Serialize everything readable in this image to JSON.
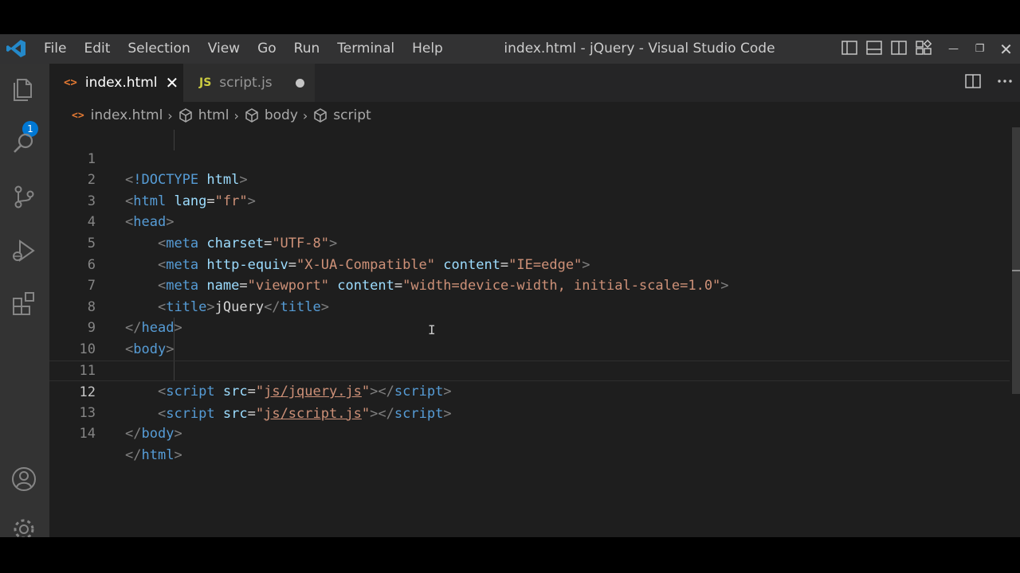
{
  "window": {
    "title": "index.html - jQuery - Visual Studio Code",
    "menu": [
      "File",
      "Edit",
      "Selection",
      "View",
      "Go",
      "Run",
      "Terminal",
      "Help"
    ]
  },
  "activity": {
    "explorer_badge": "1",
    "icons": [
      "files-icon",
      "search-icon",
      "source-control-icon",
      "run-debug-icon",
      "extensions-icon",
      "account-icon",
      "settings-gear-icon"
    ]
  },
  "tabs": [
    {
      "label": "index.html",
      "icon": "<>",
      "active": true
    },
    {
      "label": "script.js",
      "icon": "JS",
      "active": false,
      "modified": true
    }
  ],
  "breadcrumb": [
    "index.html",
    "html",
    "body",
    "script"
  ],
  "editor": {
    "line_numbers": [
      "1",
      "2",
      "3",
      "4",
      "5",
      "6",
      "7",
      "8",
      "9",
      "10",
      "11",
      "12",
      "13",
      "14"
    ],
    "current_line": "12",
    "code": {
      "l1": {
        "doctype": "!DOCTYPE",
        "html": "html"
      },
      "l2": {
        "tag": "html",
        "attr": "lang",
        "val": "\"fr\""
      },
      "l3": {
        "tag": "head"
      },
      "l4": {
        "tag": "meta",
        "attr": "charset",
        "val": "\"UTF-8\""
      },
      "l5": {
        "tag": "meta",
        "attr1": "http-equiv",
        "val1": "\"X-UA-Compatible\"",
        "attr2": "content",
        "val2": "\"IE=edge\""
      },
      "l6": {
        "tag": "meta",
        "attr1": "name",
        "val1": "\"viewport\"",
        "attr2": "content",
        "val2": "\"width=device-width, initial-scale=1.0\""
      },
      "l7": {
        "tag": "title",
        "text": "jQuery"
      },
      "l8": {
        "tag": "head"
      },
      "l9": {
        "tag": "body"
      },
      "l11": {
        "tag": "script",
        "attr": "src",
        "q": "\"",
        "path": "js/jquery.js"
      },
      "l12": {
        "tag": "script",
        "attr": "src",
        "q": "\"",
        "path": "js/script.js"
      },
      "l13": {
        "tag": "body"
      },
      "l14": {
        "tag": "html"
      }
    }
  },
  "colors": {
    "tag": "#569cd6",
    "attribute": "#9cdcfe",
    "string": "#ce9178",
    "bracket": "#808080",
    "accent": "#0078d4"
  }
}
